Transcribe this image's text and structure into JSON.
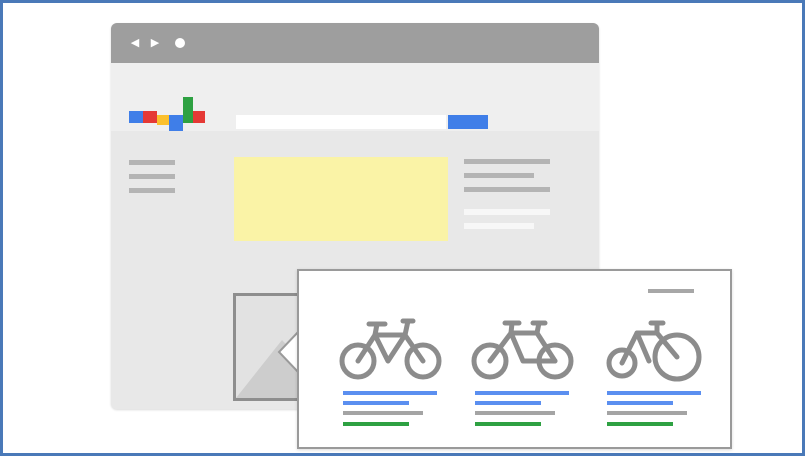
{
  "illustration": {
    "browser": {
      "nav_icons": [
        "back-arrow-icon",
        "forward-arrow-icon",
        "reload-dot-icon"
      ],
      "nav_glyphs": {
        "back": "◀",
        "forward": "▶"
      },
      "logo_colors": [
        "#3f7ee8",
        "#e53935",
        "#fbc02d",
        "#3f7ee8",
        "#2ea142",
        "#e53935"
      ],
      "search_button_color": "#3f7ee8",
      "ad_highlight_color": "#faf3a6"
    },
    "popup": {
      "products": [
        {
          "icon": "bicycle-icon",
          "style": "standard"
        },
        {
          "icon": "bicycle-icon",
          "style": "step-through"
        },
        {
          "icon": "bicycle-icon",
          "style": "road"
        }
      ],
      "line_colors": {
        "title": "#5b8ff0",
        "description": "#a4a4a4",
        "price": "#2ea142"
      }
    }
  }
}
